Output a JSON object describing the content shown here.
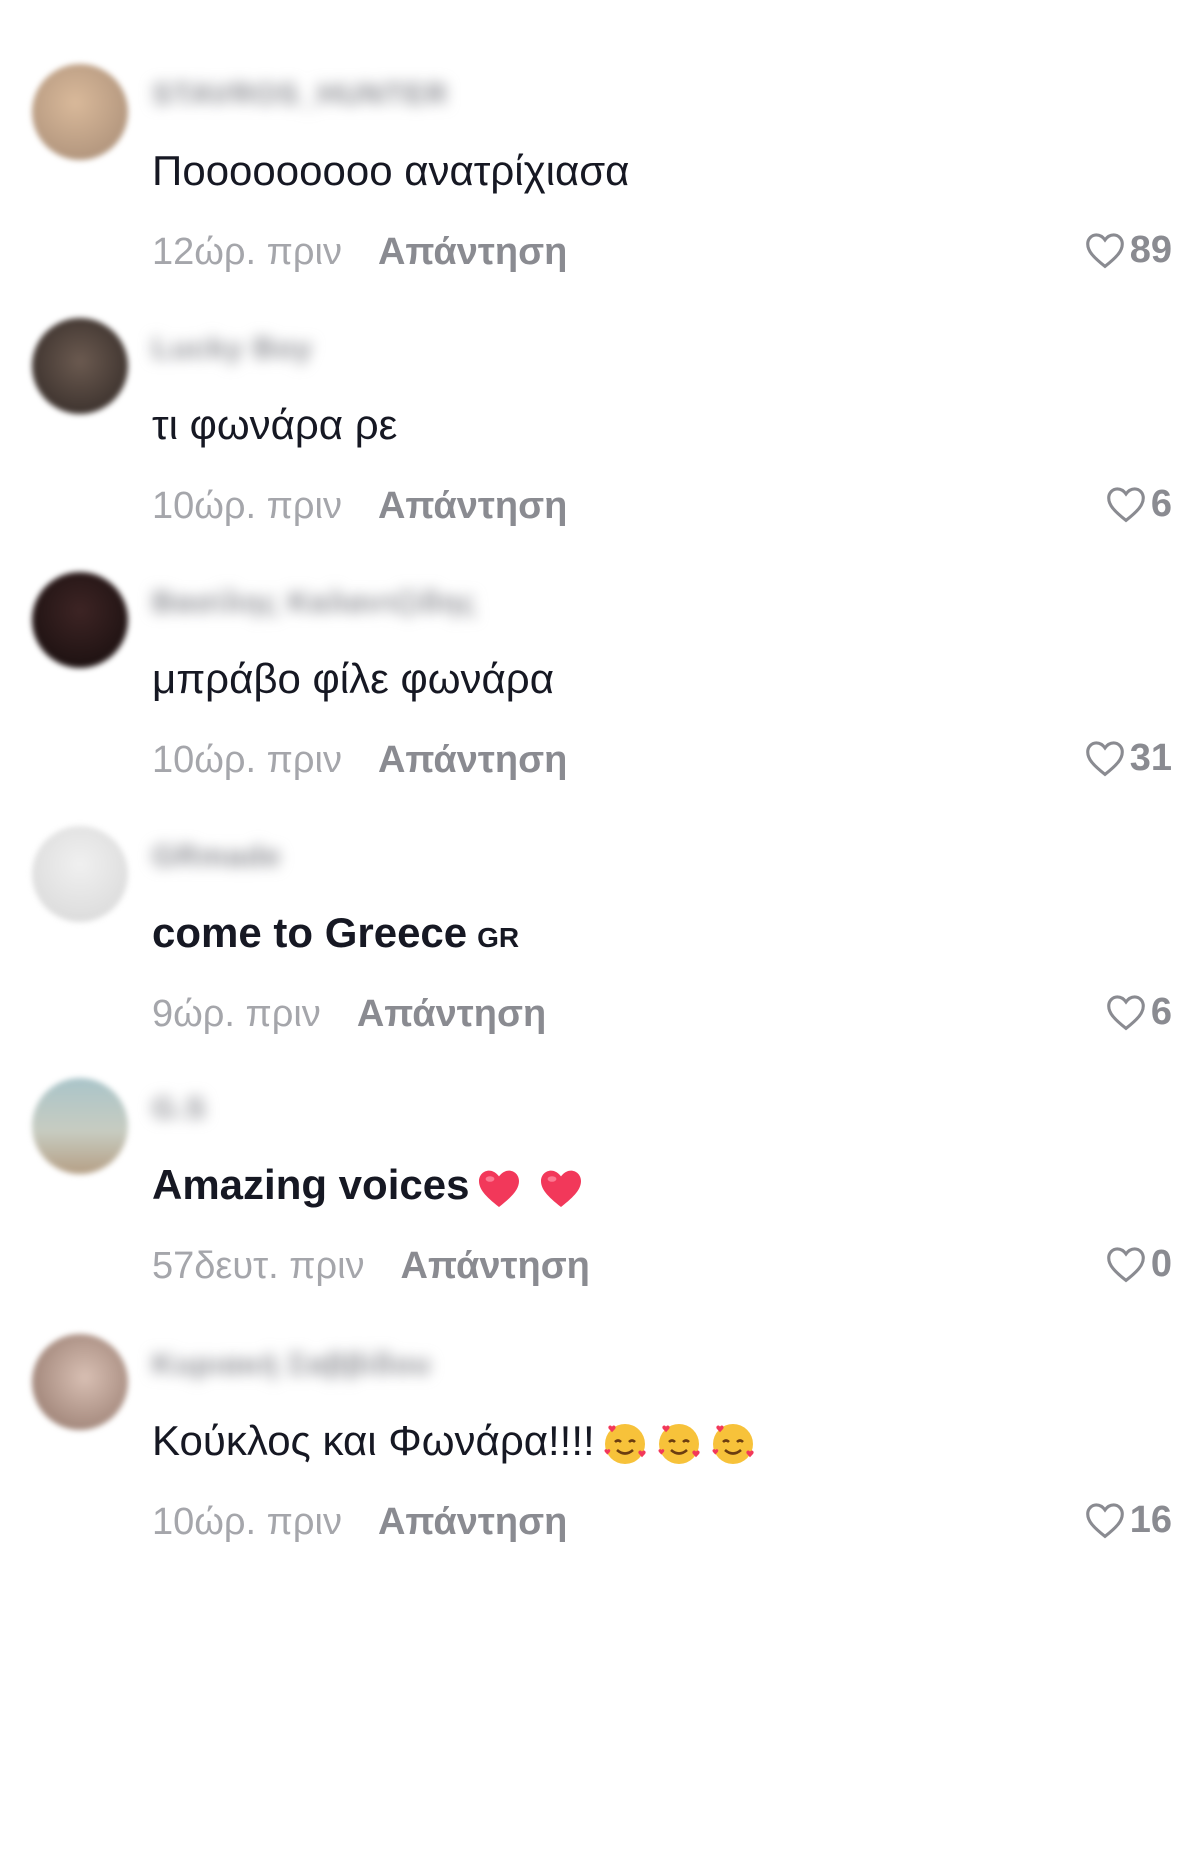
{
  "reply_label": "Απάντηση",
  "comments": [
    {
      "username": "STAVROS_HUNTER",
      "text": "Ποοοοοοοοο ανατρίχιασα",
      "time": "12ώρ. πριν",
      "likes": "89",
      "avatar_color": "#c9a98d"
    },
    {
      "username": "Lucky Boy",
      "text": "τι φωνάρα ρε",
      "time": "10ώρ. πριν",
      "likes": "6",
      "avatar_color": "#4a3f3a"
    },
    {
      "username": "Βασίλης Καλαντζίδης",
      "text": "μπράβο φίλε φωνάρα",
      "time": "10ώρ. πριν",
      "likes": "31",
      "avatar_color": "#2a1a1a"
    },
    {
      "username": "GRmade",
      "text": "come to Greece",
      "flag": "GR",
      "time": "9ώρ. πριν",
      "likes": "6",
      "avatar_color": "#e3e3e3"
    },
    {
      "username": "G.S",
      "text": "Amazing voices",
      "time": "57δευτ. πριν",
      "likes": "0",
      "avatar_color": "#b9c0b2"
    },
    {
      "username": "Κυριακή Σαββίδου",
      "text": "Κούκλος και Φωνάρα!!!!",
      "time": "10ώρ. πριν",
      "likes": "16",
      "avatar_color": "#b89a8e"
    }
  ]
}
